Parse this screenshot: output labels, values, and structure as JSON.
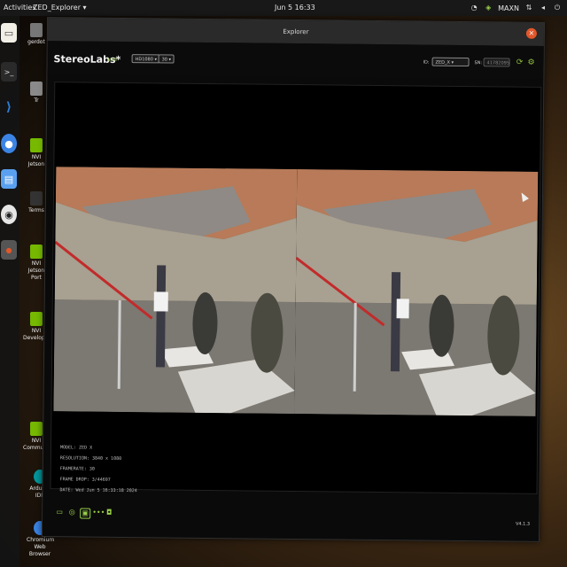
{
  "topbar": {
    "activities": "Activities",
    "app_menu": "ZED_Explorer ▾",
    "clock": "Jun 5 16:33",
    "power_mode": "MAXN"
  },
  "dock": {
    "items": [
      {
        "name": "files",
        "color": "#f2efe6"
      },
      {
        "name": "terminal",
        "color": "#2a2a2a"
      },
      {
        "name": "vscode",
        "color": "#2d7fd6"
      },
      {
        "name": "chromium",
        "color": "#3b84e5"
      },
      {
        "name": "editor",
        "color": "#5aa0f0"
      },
      {
        "name": "obs",
        "color": "#e6e6e6"
      },
      {
        "name": "zed-explorer",
        "color": "#555555"
      }
    ]
  },
  "desktop": {
    "icons": [
      {
        "label": "gerdot"
      },
      {
        "label": "Tr"
      },
      {
        "label": "NVI Jetson"
      },
      {
        "label": "Terms"
      },
      {
        "label": "NVI Jetson Port"
      },
      {
        "label": "NVI Developer"
      },
      {
        "label": "NVI Community"
      },
      {
        "label": "Arduino IDE"
      },
      {
        "label": "Chromium Web Browser"
      }
    ]
  },
  "window": {
    "title": "Explorer",
    "brand": "StereoLabs*",
    "live": "LIVE",
    "resolution_select": "HD1080 ▾",
    "fps_select": "30 ▾",
    "id_label": "ID:",
    "id_select": "ZED_X ▾",
    "sn_label": "SN:",
    "sn_value": "41782095",
    "info": {
      "model": "MODEL: ZED X",
      "resolution": "RESOLUTION: 3840 x 1080",
      "framerate": "FRAMERATE: 30",
      "frame_drop": "FRAME DROP: 3/44697",
      "date": "DATE: Wed Jun 5 16:33:18 2024"
    },
    "version": "V4.1.3"
  },
  "colors": {
    "accent": "#9ad04a",
    "close": "#e2572a",
    "window_bg": "#0a0a0a"
  }
}
